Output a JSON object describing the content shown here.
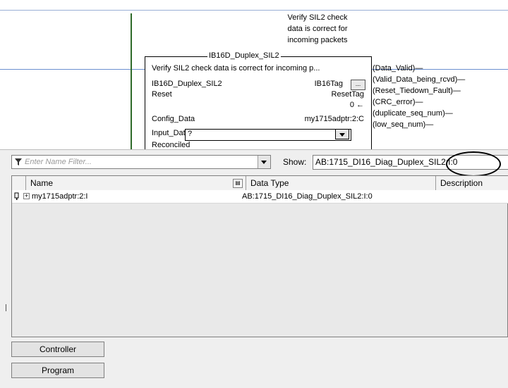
{
  "ladder": {
    "rung_comment": [
      "Verify SIL2 check",
      "data is correct for",
      "incoming packets"
    ],
    "aoi": {
      "title": "IB16D_Duplex_SIL2",
      "description": "Verify SIL2 check data is correct for incoming p...",
      "rows": [
        {
          "label": "IB16D_Duplex_SIL2",
          "value": "IB16Tag"
        },
        {
          "label": "Reset",
          "value": "ResetTag"
        },
        {
          "label": "",
          "value": "0 ←"
        },
        {
          "label": "Config_Data",
          "value": "my1715adptr:2:C"
        },
        {
          "label": "Input_Data",
          "value": "?"
        },
        {
          "label": "Reconciled",
          "value": ""
        }
      ],
      "ellipsis": "..."
    },
    "coils": [
      "(Data_Valid)—",
      "(Valid_Data_being_rcvd)—",
      "(Reset_Tiedown_Fault)—",
      "(CRC_error)—",
      "(duplicate_seq_num)—",
      "(low_seq_num)—"
    ]
  },
  "browser": {
    "filter": {
      "placeholder": "Enter Name Filter...",
      "icon": "filter-icon"
    },
    "show": {
      "label": "Show:",
      "value": "AB:1715_DI16_Diag_Duplex_SIL2:I:0"
    },
    "columns": [
      "Name",
      "Data Type",
      "Description"
    ],
    "rows": [
      {
        "expander": "+",
        "name": "my1715adptr:2:I",
        "data_type": "AB:1715_DI16_Diag_Duplex_SIL2:I:0",
        "description": ""
      }
    ],
    "scope_buttons": [
      "Controller",
      "Program"
    ]
  }
}
